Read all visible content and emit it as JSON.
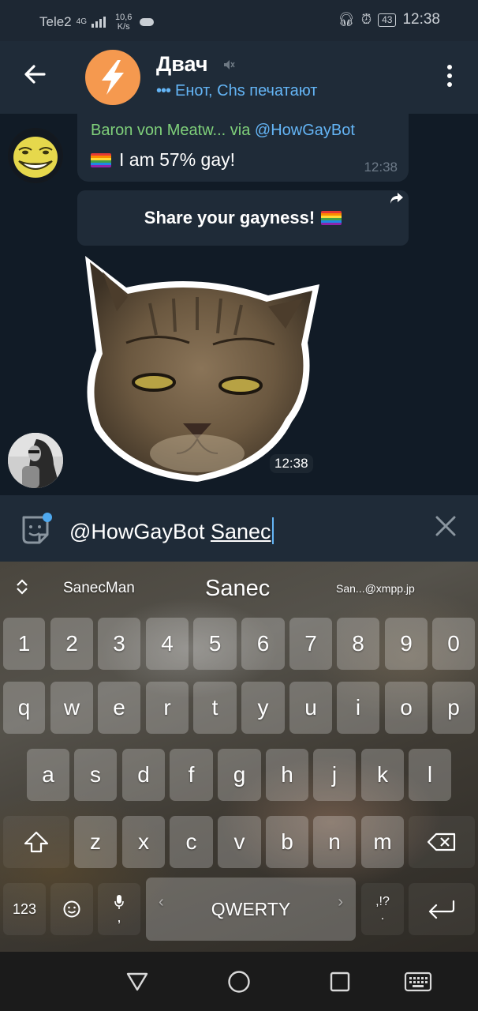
{
  "status_bar": {
    "carrier": "Tele2",
    "network": "4G",
    "speed_value": "10,6",
    "speed_unit": "K/s",
    "battery": "43",
    "time": "12:38"
  },
  "header": {
    "title": "Двач",
    "typing_indicator": "•••",
    "status": "Енот, Chs печатают"
  },
  "messages": [
    {
      "sender": "Baron von Meatw...",
      "via": "via",
      "bot": "@HowGayBot",
      "text": "I am 57% gay!",
      "time": "12:38",
      "inline_button": "Share your gayness!"
    },
    {
      "type": "sticker",
      "time": "12:38"
    }
  ],
  "composer": {
    "prefix": "@HowGayBot ",
    "underlined": "Sanec"
  },
  "keyboard": {
    "suggestions": [
      "SanecMan",
      "Sanec",
      "San...@xmpp.jp"
    ],
    "row_numbers": [
      "1",
      "2",
      "3",
      "4",
      "5",
      "6",
      "7",
      "8",
      "9",
      "0"
    ],
    "row1": [
      "q",
      "w",
      "e",
      "r",
      "t",
      "y",
      "u",
      "i",
      "o",
      "p"
    ],
    "row2": [
      "a",
      "s",
      "d",
      "f",
      "g",
      "h",
      "j",
      "k",
      "l"
    ],
    "row3": [
      "z",
      "x",
      "c",
      "v",
      "b",
      "n",
      "m"
    ],
    "symbols_key": "123",
    "comma_key": ",",
    "space_label": "QWERTY",
    "punct_top": ",!?",
    "punct_bottom": "."
  },
  "colors": {
    "accent": "#64b5f6",
    "sender": "#7fd07a",
    "channel_avatar": "#f5994f",
    "chat_bg": "#111b26",
    "panel": "#1f2b38"
  },
  "icons": [
    "back-arrow-icon",
    "lightning-icon",
    "mute-icon",
    "more-vert-icon",
    "share-icon",
    "sticker-icon",
    "clear-icon",
    "shift-icon",
    "backspace-icon",
    "emoji-icon",
    "mic-icon",
    "enter-icon",
    "nav-back-icon",
    "nav-home-icon",
    "nav-recents-icon",
    "nav-keyboard-icon",
    "headphones-icon",
    "alarm-icon"
  ]
}
